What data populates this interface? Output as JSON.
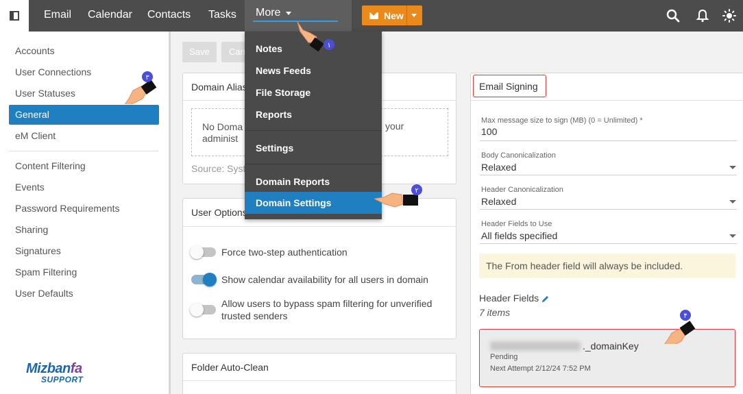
{
  "topbar": {
    "nav": [
      "Email",
      "Calendar",
      "Contacts",
      "Tasks"
    ],
    "more_label": "More",
    "new_label": "New"
  },
  "more_menu": {
    "items": [
      "Notes",
      "News Feeds",
      "File Storage",
      "Reports"
    ],
    "settings": "Settings",
    "domain_reports": "Domain Reports",
    "domain_settings": "Domain Settings"
  },
  "sidebar": {
    "group1": [
      "Accounts",
      "User Connections",
      "User Statuses"
    ],
    "active": "General",
    "after_active": "eM Client",
    "group2": [
      "Content Filtering",
      "Events",
      "Password Requirements",
      "Sharing",
      "Signatures",
      "Spam Filtering",
      "User Defaults"
    ]
  },
  "logo": {
    "main_a": "Mizban",
    "main_b": "fa",
    "sub": "SUPPORT"
  },
  "toolbar": {
    "save": "Save",
    "cancel": "Can"
  },
  "domain_aliases": {
    "title": "Domain Alias",
    "empty_a": "No Doma",
    "empty_a_end": "your",
    "empty_b": "administ",
    "source": "Source: Syst"
  },
  "user_options": {
    "title": "User Options",
    "toggles": [
      {
        "label": "Force two-step authentication",
        "on": false
      },
      {
        "label": "Show calendar availability for all users in domain",
        "on": true
      },
      {
        "label": "Allow users to bypass spam filtering for unverified trusted senders",
        "on": false
      }
    ]
  },
  "folder_autoclean": {
    "title": "Folder Auto-Clean"
  },
  "email_signing": {
    "title": "Email Signing",
    "max_size_label": "Max message size to sign (MB) (0 = Unlimited) *",
    "max_size_value": "100",
    "body_canon_label": "Body Canonicalization",
    "body_canon_value": "Relaxed",
    "header_canon_label": "Header Canonicalization",
    "header_canon_value": "Relaxed",
    "header_fields_use_label": "Header Fields to Use",
    "header_fields_use_value": "All fields specified",
    "info": "The From header field will always be included.",
    "header_fields_title": "Header Fields",
    "header_fields_count": "7 items",
    "key_suffix": "._domainKey",
    "key_status": "Pending",
    "key_attempt": "Next Attempt 2/12/24 7:52 PM"
  },
  "markers": [
    "۱",
    "۲",
    "۳",
    "۴"
  ],
  "colors": {
    "topbar": "#4c4c4c",
    "accent": "#1f7fc1",
    "new": "#ea8a1d",
    "highlight": "#d63c3c"
  }
}
